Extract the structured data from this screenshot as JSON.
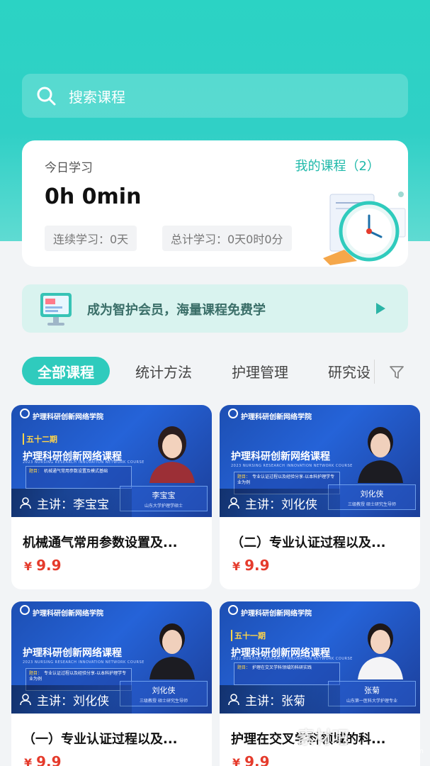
{
  "search": {
    "placeholder": "搜索课程"
  },
  "study": {
    "title": "今日学习",
    "my_courses": "我的课程（2）",
    "time": "0h 0min",
    "consecutive": "连续学习：0天",
    "total": "总计学习：0天0时0分"
  },
  "banner": {
    "text": "成为智护会员，海量课程免费学"
  },
  "tabs": [
    {
      "label": "全部课程",
      "active": true
    },
    {
      "label": "统计方法"
    },
    {
      "label": "护理管理"
    },
    {
      "label": "研究设"
    }
  ],
  "courses": [
    {
      "brand": "护理科研创新网络学院",
      "period": "五十二期",
      "program": "护理科研创新网络课程",
      "program_en": "2023 NURSING RESEARCH INNOVATION NETWORK COURSE",
      "topic_label": "题目：",
      "topic": "机械通气常用参数设置及模式基础",
      "teacher_name": "李宝宝",
      "teacher_title": "山东大学护理学硕士",
      "lecturer": "主讲：李宝宝",
      "title": "机械通气常用参数设置及...",
      "currency": "¥",
      "price": "9.9"
    },
    {
      "brand": "护理科研创新网络学院",
      "period": "",
      "program": "护理科研创新网络课程",
      "program_en": "2023 NURSING RESEARCH INNOVATION NETWORK COURSE",
      "topic_label": "题目：",
      "topic": "专业认证过程以及经验分享-以本科护理学专业为例",
      "teacher_name": "刘化侠",
      "teacher_title": "三级教授 硕士研究生导师",
      "lecturer": "主讲：刘化侠",
      "title": "（二）专业认证过程以及...",
      "currency": "¥",
      "price": "9.9"
    },
    {
      "brand": "护理科研创新网络学院",
      "period": "",
      "program": "护理科研创新网络课程",
      "program_en": "2023 NURSING RESEARCH INNOVATION NETWORK COURSE",
      "topic_label": "题目：",
      "topic": "专业认证过程以及经验分享-以本科护理学专业为例",
      "teacher_name": "刘化侠",
      "teacher_title": "三级教授 硕士研究生导师",
      "lecturer": "主讲：刘化侠",
      "title": "（一）专业认证过程以及...",
      "currency": "¥",
      "price": "9.9"
    },
    {
      "brand": "护理科研创新网络学院",
      "period": "五十一期",
      "program": "护理科研创新网络课程",
      "program_en": "2022 NURSING RESEARCH INNOVATION NETWORK COURSE",
      "topic_label": "题目：",
      "topic": "护理在交叉学科领域的科研实践",
      "teacher_name": "张菊",
      "teacher_title": "山东第一医科大学护理专业",
      "lecturer": "主讲：张菊",
      "title": "护理在交叉学科领域的科...",
      "currency": "¥",
      "price": "9.9"
    }
  ],
  "watermark": {
    "text": "素材吧",
    "url": "www.sucaibar.com"
  },
  "colors": {
    "brand": "#2fcbbd",
    "price": "#e53b2c",
    "thumb": "#2563d8"
  }
}
